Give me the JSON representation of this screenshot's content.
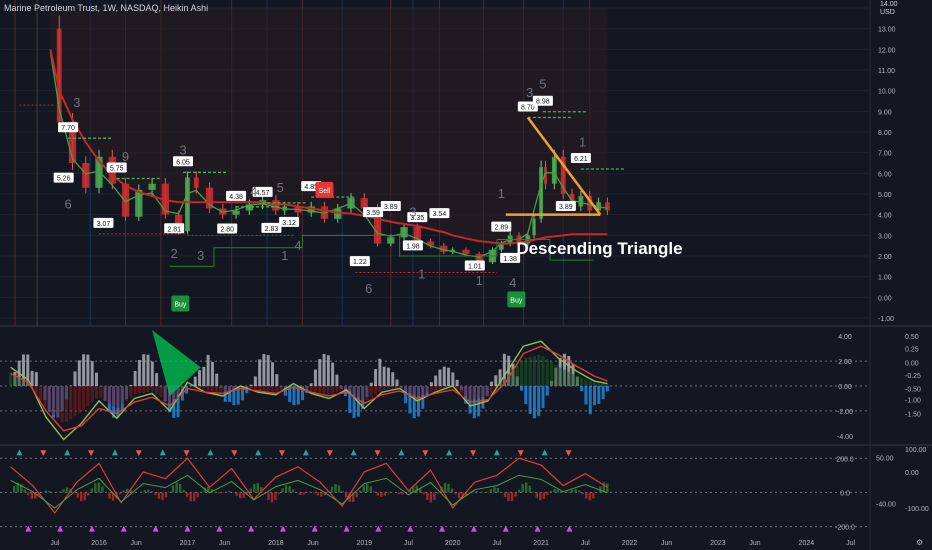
{
  "header": {
    "title": "Marine Petroleum Trust, 1W, NASDAQ, Heikin Ashi",
    "currency_top": "14.00",
    "currency": "USD"
  },
  "colors": {
    "background": "#131722",
    "grid": "#2a2e39",
    "price_candle": "#d1d4dc",
    "bull": "#26a69a",
    "bear": "#ef5350",
    "ma_slow": "#c62828",
    "trendline": "#f0a030",
    "green_line": "#4caf50",
    "label_bg": "#ffffff",
    "label_text": "#131722",
    "buy": "#1b8f3c",
    "sell": "#e53935"
  },
  "chart_data": [
    {
      "type": "line",
      "panel": "price",
      "title": "Marine Petroleum Trust, 1W, NASDAQ, Heikin Ashi",
      "ylim": [
        -1.0,
        14.0
      ],
      "y_ticks": [
        "14.00",
        "13.00",
        "12.00",
        "11.00",
        "10.00",
        "9.00",
        "8.00",
        "7.00",
        "6.00",
        "5.00",
        "4.00",
        "3.00",
        "2.00",
        "1.00",
        "0.00",
        "-1.00"
      ],
      "x": [
        2015.45,
        2015.55,
        2015.7,
        2015.85,
        2016.0,
        2016.15,
        2016.3,
        2016.45,
        2016.6,
        2016.75,
        2016.9,
        2017.0,
        2017.1,
        2017.25,
        2017.4,
        2017.55,
        2017.7,
        2017.85,
        2018.0,
        2018.1,
        2018.25,
        2018.4,
        2018.55,
        2018.7,
        2018.85,
        2019.0,
        2019.15,
        2019.3,
        2019.45,
        2019.6,
        2019.75,
        2019.9,
        2020.0,
        2020.15,
        2020.3,
        2020.45,
        2020.55,
        2020.65,
        2020.75,
        2020.85,
        2020.92,
        2021.0,
        2021.05,
        2021.15,
        2021.25,
        2021.35,
        2021.45,
        2021.55,
        2021.65,
        2021.75
      ],
      "series": [
        {
          "values": [
            13.0,
            8.5,
            6.5,
            5.3,
            6.8,
            5.5,
            3.9,
            5.2,
            5.5,
            4.0,
            3.2,
            5.8,
            5.3,
            4.3,
            4.0,
            4.2,
            4.5,
            4.7,
            4.2,
            4.4,
            4.1,
            4.4,
            3.8,
            4.3,
            4.8,
            4.3,
            2.6,
            2.9,
            3.4,
            2.7,
            2.5,
            2.2,
            2.3,
            2.1,
            1.7,
            2.3,
            2.6,
            3.0,
            2.6,
            3.0,
            3.8,
            6.3,
            5.5,
            6.8,
            5.0,
            4.4,
            4.9,
            4.2,
            4.6,
            4.2
          ]
        },
        {
          "values": [
            12.0,
            10.0,
            8.6,
            7.5,
            6.6,
            5.9,
            5.4,
            5.1,
            4.9,
            4.7,
            4.6,
            4.6,
            4.6,
            4.6,
            4.6,
            4.6,
            4.6,
            4.6,
            4.5,
            4.5,
            4.4,
            4.3,
            4.2,
            4.1,
            4.05,
            3.95,
            3.8,
            3.65,
            3.55,
            3.45,
            3.3,
            3.15,
            3.0,
            2.85,
            2.72,
            2.65,
            2.6,
            2.6,
            2.65,
            2.7,
            2.78,
            2.85,
            2.9,
            2.95,
            3.0,
            3.05,
            3.05,
            3.05,
            3.05,
            3.05
          ]
        }
      ],
      "annotations": [
        {
          "text": "7.70",
          "x": 2015.65,
          "y": 7.7
        },
        {
          "text": "5.26",
          "x": 2015.6,
          "y": 5.26
        },
        {
          "text": "3.07",
          "x": 2016.05,
          "y": 3.07
        },
        {
          "text": "5.75",
          "x": 2016.2,
          "y": 5.75
        },
        {
          "text": "6.05",
          "x": 2016.95,
          "y": 6.05
        },
        {
          "text": "2.81",
          "x": 2016.85,
          "y": 2.81
        },
        {
          "text": "2.80",
          "x": 2017.45,
          "y": 2.8
        },
        {
          "text": "4.38",
          "x": 2017.55,
          "y": 4.38
        },
        {
          "text": "4.57",
          "x": 2017.85,
          "y": 4.57
        },
        {
          "text": "2.83",
          "x": 2017.95,
          "y": 2.83
        },
        {
          "text": "3.12",
          "x": 2018.15,
          "y": 3.12
        },
        {
          "text": "4.85",
          "x": 2018.4,
          "y": 4.85
        },
        {
          "text": "1.22",
          "x": 2018.95,
          "y": 1.22
        },
        {
          "text": "3.59",
          "x": 2019.1,
          "y": 3.59
        },
        {
          "text": "3.89",
          "x": 2019.3,
          "y": 3.89
        },
        {
          "text": "1.98",
          "x": 2019.55,
          "y": 1.98
        },
        {
          "text": "3.35",
          "x": 2019.6,
          "y": 3.35
        },
        {
          "text": "3.54",
          "x": 2019.85,
          "y": 3.54
        },
        {
          "text": "1.01",
          "x": 2020.25,
          "y": 1.01
        },
        {
          "text": "2.89",
          "x": 2020.55,
          "y": 2.89
        },
        {
          "text": "1.38",
          "x": 2020.65,
          "y": 1.38
        },
        {
          "text": "8.70",
          "x": 2020.85,
          "y": 8.7
        },
        {
          "text": "8.98",
          "x": 2021.02,
          "y": 8.98
        },
        {
          "text": "3.89",
          "x": 2021.28,
          "y": 3.89
        },
        {
          "text": "6.21",
          "x": 2021.45,
          "y": 6.21
        }
      ],
      "wave_counts": [
        {
          "text": "3",
          "x": 2015.75,
          "y": 9.2
        },
        {
          "text": "6",
          "x": 2015.65,
          "y": 4.3
        },
        {
          "text": "9",
          "x": 2016.3,
          "y": 6.6
        },
        {
          "text": "3",
          "x": 2016.95,
          "y": 6.9
        },
        {
          "text": "2",
          "x": 2016.85,
          "y": 1.9
        },
        {
          "text": "3",
          "x": 2017.15,
          "y": 1.8
        },
        {
          "text": "4",
          "x": 2017.75,
          "y": 4.9
        },
        {
          "text": "5",
          "x": 2018.05,
          "y": 5.1
        },
        {
          "text": "1",
          "x": 2018.1,
          "y": 1.8
        },
        {
          "text": "4",
          "x": 2018.25,
          "y": 2.3
        },
        {
          "text": "6",
          "x": 2019.05,
          "y": 0.2
        },
        {
          "text": "3",
          "x": 2019.55,
          "y": 3.9
        },
        {
          "text": "1",
          "x": 2019.65,
          "y": 0.9
        },
        {
          "text": "1",
          "x": 2020.3,
          "y": 0.6
        },
        {
          "text": "1",
          "x": 2020.55,
          "y": 4.8
        },
        {
          "text": "4",
          "x": 2020.68,
          "y": 0.5
        },
        {
          "text": "3",
          "x": 2020.87,
          "y": 9.7
        },
        {
          "text": "5",
          "x": 2021.02,
          "y": 10.1
        },
        {
          "text": "1",
          "x": 2021.47,
          "y": 7.3
        }
      ],
      "signals": [
        {
          "text": "Buy",
          "x": 2016.92,
          "y": -0.3,
          "kind": "buy"
        },
        {
          "text": "Sell",
          "x": 2018.55,
          "y": 5.2,
          "kind": "sell"
        },
        {
          "text": "Buy",
          "x": 2020.72,
          "y": -0.1,
          "kind": "buy"
        }
      ],
      "pattern_label": "Descending Triangle",
      "triangle": {
        "top": [
          [
            2020.85,
            8.7
          ],
          [
            2021.67,
            4.0
          ]
        ],
        "base": [
          [
            2020.6,
            4.0
          ],
          [
            2021.67,
            4.0
          ]
        ]
      },
      "x_ticks": [
        "Jul",
        "2016",
        "Jun",
        "2017",
        "Jun",
        "2018",
        "Jun",
        "2019",
        "Jul",
        "2020",
        "Jul",
        "2021",
        "Jul",
        "2022",
        "Jun",
        "2023",
        "Jun",
        "2024",
        "Jul"
      ],
      "x_tick_values": [
        2015.5,
        2016.0,
        2016.42,
        2017.0,
        2017.42,
        2018.0,
        2018.42,
        2019.0,
        2019.5,
        2020.0,
        2020.5,
        2021.0,
        2021.5,
        2022.0,
        2022.42,
        2023.0,
        2023.42,
        2024.0,
        2024.5
      ]
    },
    {
      "type": "line",
      "panel": "oscillator-1",
      "ylim": [
        -4.5,
        4.5
      ],
      "y_ticks_left": [
        "4.00",
        "2.00",
        "0.00",
        "-2.00",
        "-4.00"
      ],
      "y_ticks_right": [
        "0.50",
        "0.25",
        "0.00",
        "-0.25",
        "-0.50",
        "-1.00",
        "-1.50"
      ],
      "x": [
        2015.0,
        2015.2,
        2015.4,
        2015.6,
        2015.8,
        2016.0,
        2016.2,
        2016.4,
        2016.6,
        2016.8,
        2017.0,
        2017.2,
        2017.4,
        2017.6,
        2017.8,
        2018.0,
        2018.2,
        2018.4,
        2018.6,
        2018.8,
        2019.0,
        2019.2,
        2019.4,
        2019.6,
        2019.8,
        2020.0,
        2020.2,
        2020.4,
        2020.6,
        2020.8,
        2021.0,
        2021.2,
        2021.4,
        2021.6,
        2021.75
      ],
      "series": [
        {
          "values": [
            1.5,
            0.5,
            -2.5,
            -4.3,
            -3.0,
            -1.2,
            -2.6,
            -1.0,
            -0.6,
            -2.0,
            0.3,
            -0.5,
            -0.8,
            0.0,
            -0.5,
            -0.7,
            0.2,
            -0.6,
            -1.0,
            -0.3,
            -1.8,
            -0.5,
            -0.2,
            -1.2,
            -0.5,
            0.0,
            -1.6,
            -1.2,
            1.0,
            3.2,
            3.6,
            2.2,
            1.2,
            0.4,
            0.2
          ]
        },
        {
          "values": [
            1.0,
            0.3,
            -2.0,
            -3.6,
            -3.2,
            -1.8,
            -2.2,
            -1.3,
            -0.9,
            -1.6,
            -0.2,
            -0.5,
            -0.6,
            -0.2,
            -0.4,
            -0.6,
            -0.1,
            -0.5,
            -0.8,
            -0.5,
            -1.4,
            -0.7,
            -0.4,
            -1.0,
            -0.6,
            -0.3,
            -1.3,
            -1.1,
            0.3,
            2.6,
            3.2,
            2.5,
            1.6,
            0.8,
            0.4
          ]
        }
      ]
    },
    {
      "type": "line",
      "panel": "oscillator-2",
      "ylim": [
        -220,
        260
      ],
      "y_ticks_left": [
        "200.0",
        "0.0",
        "-200.0"
      ],
      "y_ticks_right_a": [
        "100.00",
        "50.00",
        "0.00",
        "-40.00",
        "-100.00"
      ],
      "x": [
        2015.0,
        2015.25,
        2015.5,
        2015.75,
        2016.0,
        2016.25,
        2016.5,
        2016.75,
        2017.0,
        2017.25,
        2017.5,
        2017.75,
        2018.0,
        2018.25,
        2018.5,
        2018.75,
        2019.0,
        2019.25,
        2019.5,
        2019.75,
        2020.0,
        2020.25,
        2020.5,
        2020.75,
        2021.0,
        2021.25,
        2021.5,
        2021.75
      ],
      "series": [
        {
          "values": [
            150,
            40,
            -120,
            60,
            170,
            -60,
            120,
            80,
            200,
            30,
            140,
            -40,
            90,
            150,
            60,
            -80,
            120,
            170,
            10,
            130,
            -90,
            60,
            100,
            200,
            160,
            40,
            110,
            30
          ]
        }
      ]
    }
  ]
}
